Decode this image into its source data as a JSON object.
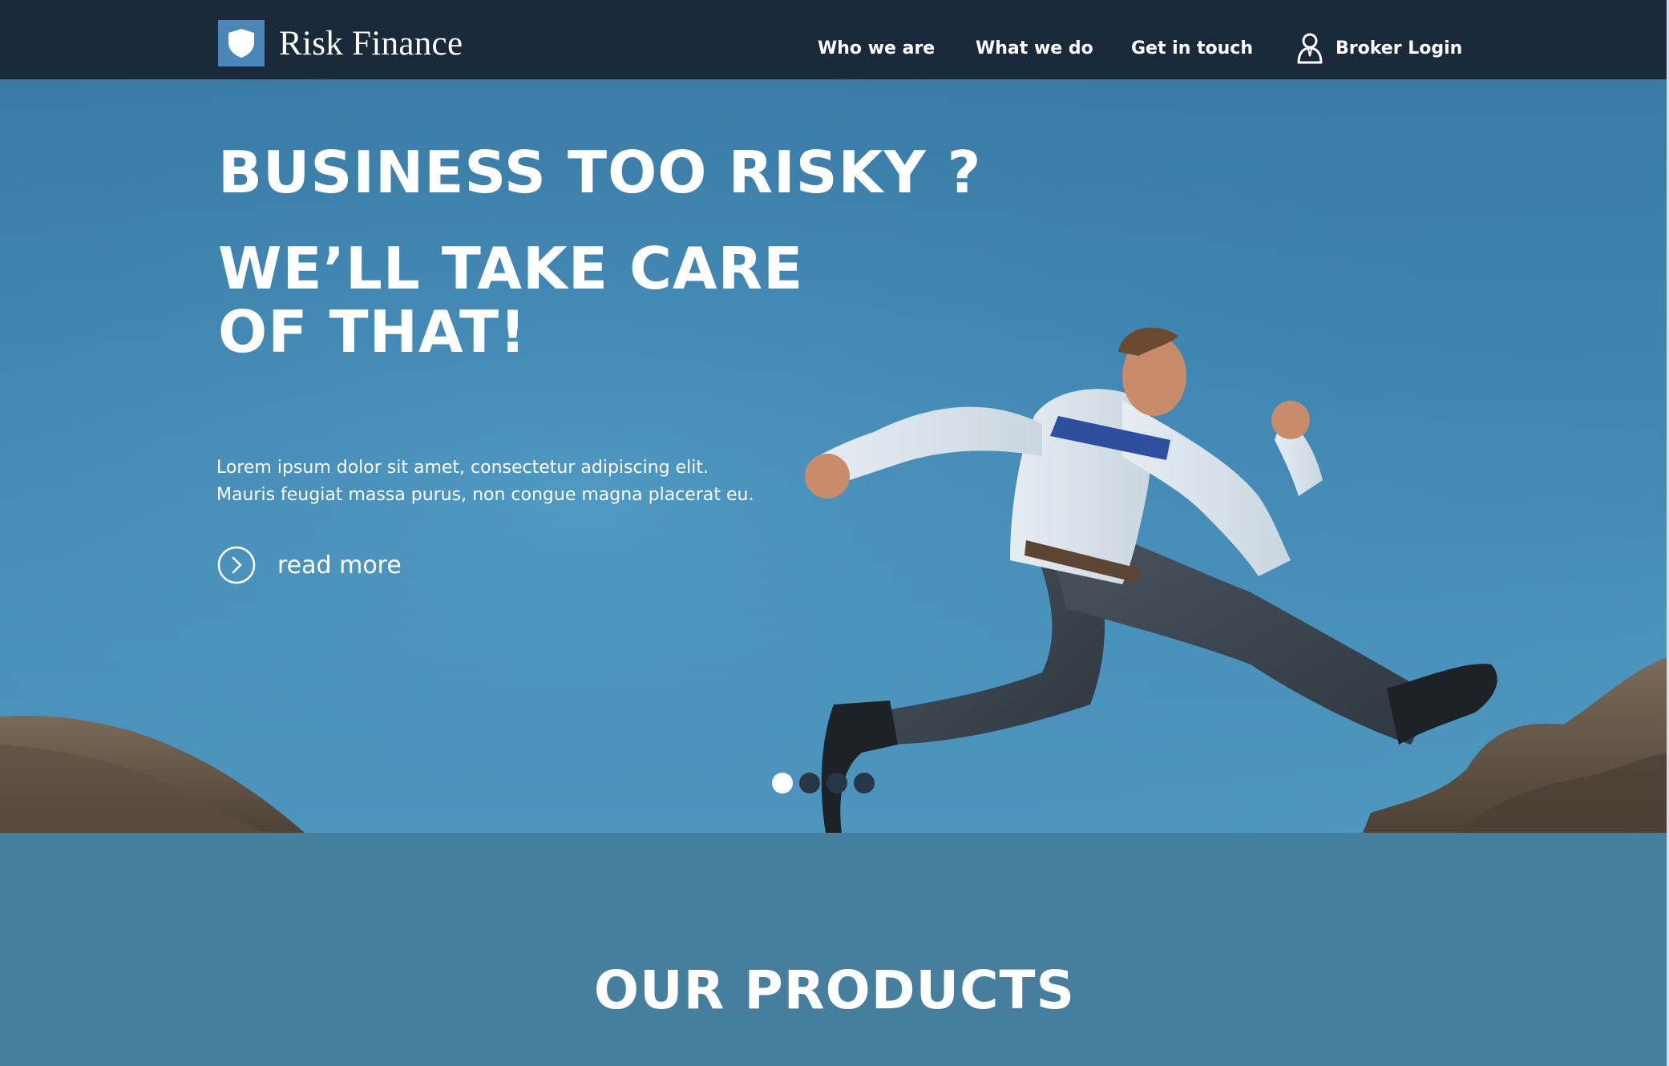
{
  "brand": {
    "name": "Risk Finance",
    "logo_icon": "shield-icon"
  },
  "nav": {
    "items": [
      {
        "label": "Who we are"
      },
      {
        "label": "What we do"
      },
      {
        "label": "Get in touch"
      }
    ],
    "login": {
      "label": "Broker Login",
      "icon": "user-icon"
    }
  },
  "hero": {
    "headline": "BUSINESS  TOO RISKY ?",
    "subheadline_line1": "WE’LL TAKE CARE",
    "subheadline_line2": "OF THAT!",
    "body_line1": "Lorem ipsum dolor sit amet, consectetur adipiscing elit.",
    "body_line2": "Mauris feugiat massa purus, non congue magna placerat eu.",
    "cta": {
      "label": "read more",
      "icon": "chevron-right-circle-icon"
    },
    "carousel": {
      "slides": 4,
      "active": 1
    }
  },
  "products": {
    "title": "OUR PRODUCTS"
  },
  "colors": {
    "header_bg": "#1a2a3a",
    "accent": "#4a86b8",
    "hero_sky": "#3f86b2",
    "products_bg": "#467f9e",
    "dot_inactive": "#263746",
    "dot_active": "#ffffff"
  }
}
